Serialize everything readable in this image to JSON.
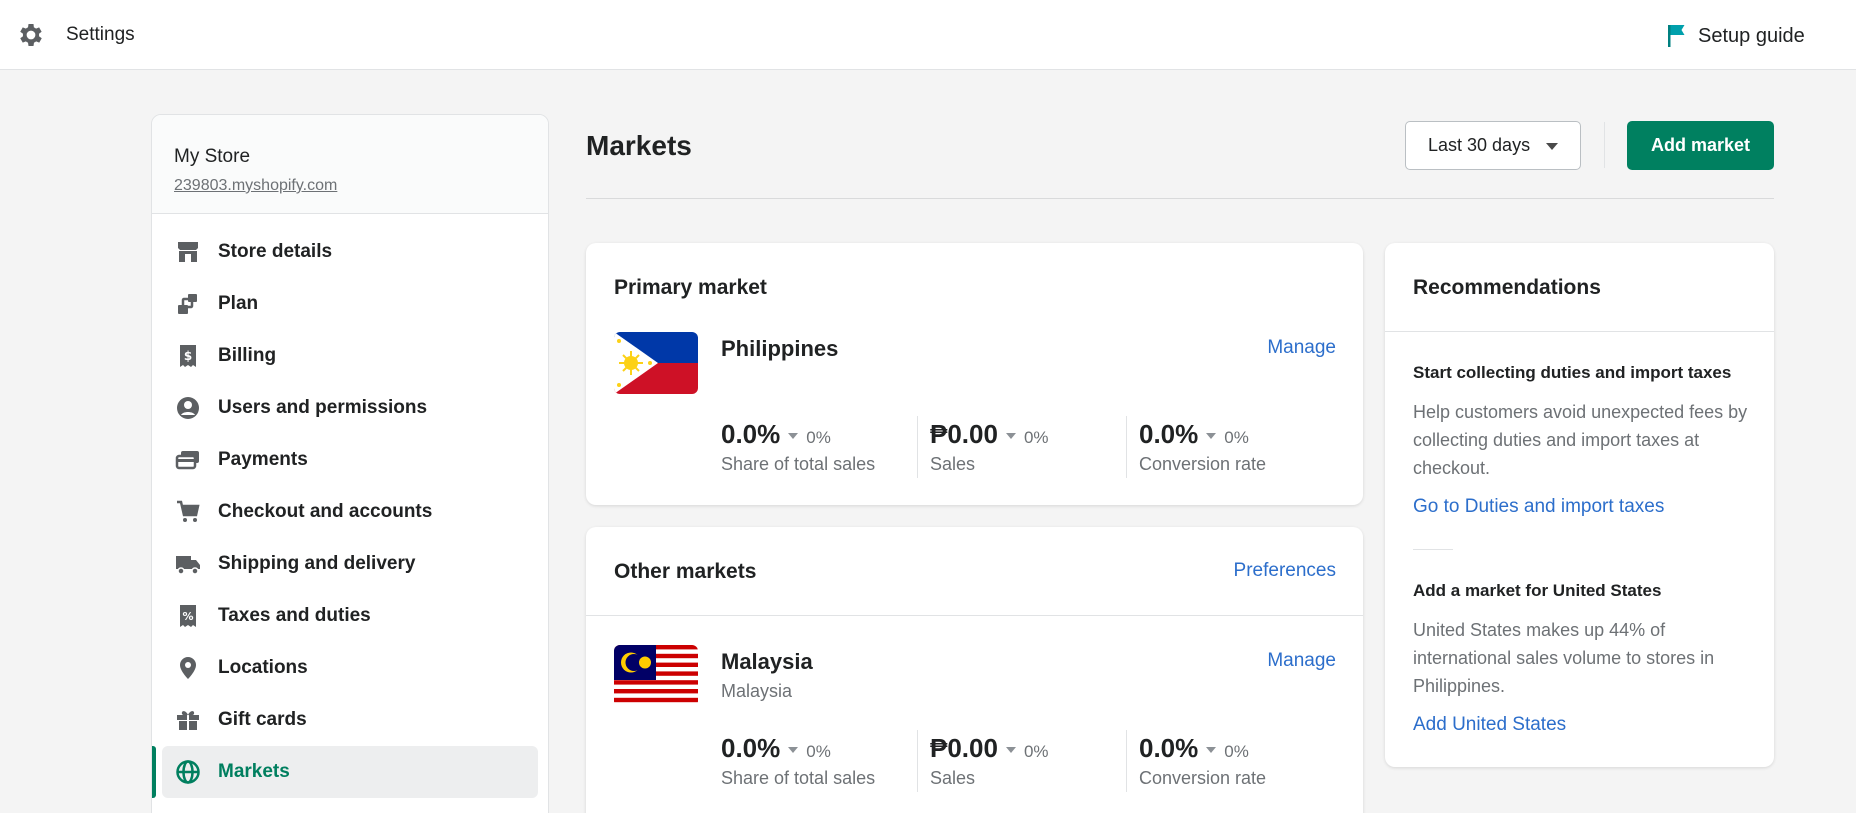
{
  "topbar": {
    "title": "Settings",
    "setup_guide": "Setup guide",
    "icon": "gear-icon"
  },
  "sidebar": {
    "store_name": "My Store",
    "store_url": "239803.myshopify.com",
    "items": [
      {
        "label": "Store details",
        "icon": "store-icon"
      },
      {
        "label": "Plan",
        "icon": "plan-icon"
      },
      {
        "label": "Billing",
        "icon": "billing-icon"
      },
      {
        "label": "Users and permissions",
        "icon": "user-icon"
      },
      {
        "label": "Payments",
        "icon": "payments-icon"
      },
      {
        "label": "Checkout and accounts",
        "icon": "cart-icon"
      },
      {
        "label": "Shipping and delivery",
        "icon": "truck-icon"
      },
      {
        "label": "Taxes and duties",
        "icon": "tax-icon"
      },
      {
        "label": "Locations",
        "icon": "location-pin-icon"
      },
      {
        "label": "Gift cards",
        "icon": "gift-icon"
      },
      {
        "label": "Markets",
        "icon": "globe-icon",
        "active": true
      }
    ]
  },
  "header": {
    "title": "Markets",
    "date_range": "Last 30 days",
    "add_market": "Add market"
  },
  "primary_market": {
    "title": "Primary market",
    "country": "Philippines",
    "manage": "Manage",
    "metrics": [
      {
        "value": "0.0%",
        "change": "0%",
        "caption": "Share of total sales"
      },
      {
        "value": "₱0.00",
        "change": "0%",
        "caption": "Sales"
      },
      {
        "value": "0.0%",
        "change": "0%",
        "caption": "Conversion rate"
      }
    ]
  },
  "other_markets": {
    "title": "Other markets",
    "preferences": "Preferences",
    "country": "Malaysia",
    "country_sub": "Malaysia",
    "manage": "Manage",
    "metrics": [
      {
        "value": "0.0%",
        "change": "0%",
        "caption": "Share of total sales"
      },
      {
        "value": "₱0.00",
        "change": "0%",
        "caption": "Sales"
      },
      {
        "value": "0.0%",
        "change": "0%",
        "caption": "Conversion rate"
      }
    ]
  },
  "recommendations": {
    "title": "Recommendations",
    "items": [
      {
        "heading": "Start collecting duties and import taxes",
        "body": "Help customers avoid unexpected fees by collecting duties and import taxes at checkout.",
        "link": "Go to Duties and import taxes"
      },
      {
        "heading": "Add a market for United States",
        "body": "United States makes up 44% of international sales volume to stores in Philippines.",
        "link": "Add United States"
      }
    ]
  },
  "colors": {
    "accent": "#008060",
    "link": "#2c6ecb",
    "active_nav": "#007f5f"
  }
}
